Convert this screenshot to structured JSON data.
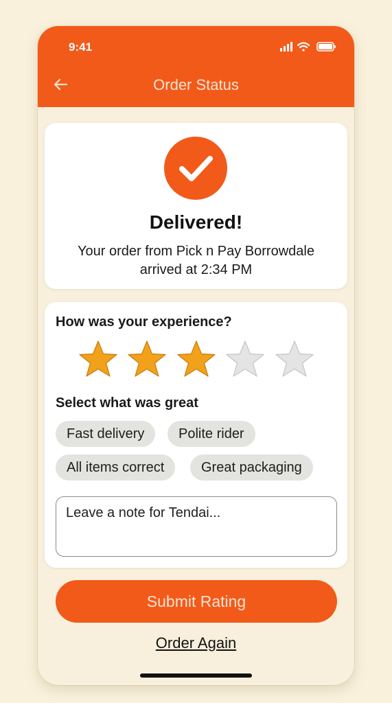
{
  "status_bar": {
    "time": "9:41"
  },
  "nav": {
    "title": "Order Status",
    "back_icon": "arrow-left-icon"
  },
  "delivered": {
    "title": "Delivered!",
    "message_line1": "Your order from Pick n Pay Borrowdale",
    "message_line2": "arrived at 2:34 PM",
    "icon": "check-icon"
  },
  "rating": {
    "question": "How was your experience?",
    "stars_selected": 3,
    "stars_total": 5,
    "select_label": "Select what was great",
    "chips": [
      "Fast delivery",
      "Polite rider",
      "All items correct",
      "Great packaging"
    ],
    "note_placeholder": "Leave a note for Tendai..."
  },
  "actions": {
    "submit_label": "Submit Rating",
    "order_again_label": "Order Again"
  },
  "colors": {
    "accent": "#f25a1a",
    "background": "#f8f0dc",
    "star_filled": "#f2a21a",
    "star_empty": "#e4e4e4",
    "chip_bg": "#e3e3e0"
  }
}
